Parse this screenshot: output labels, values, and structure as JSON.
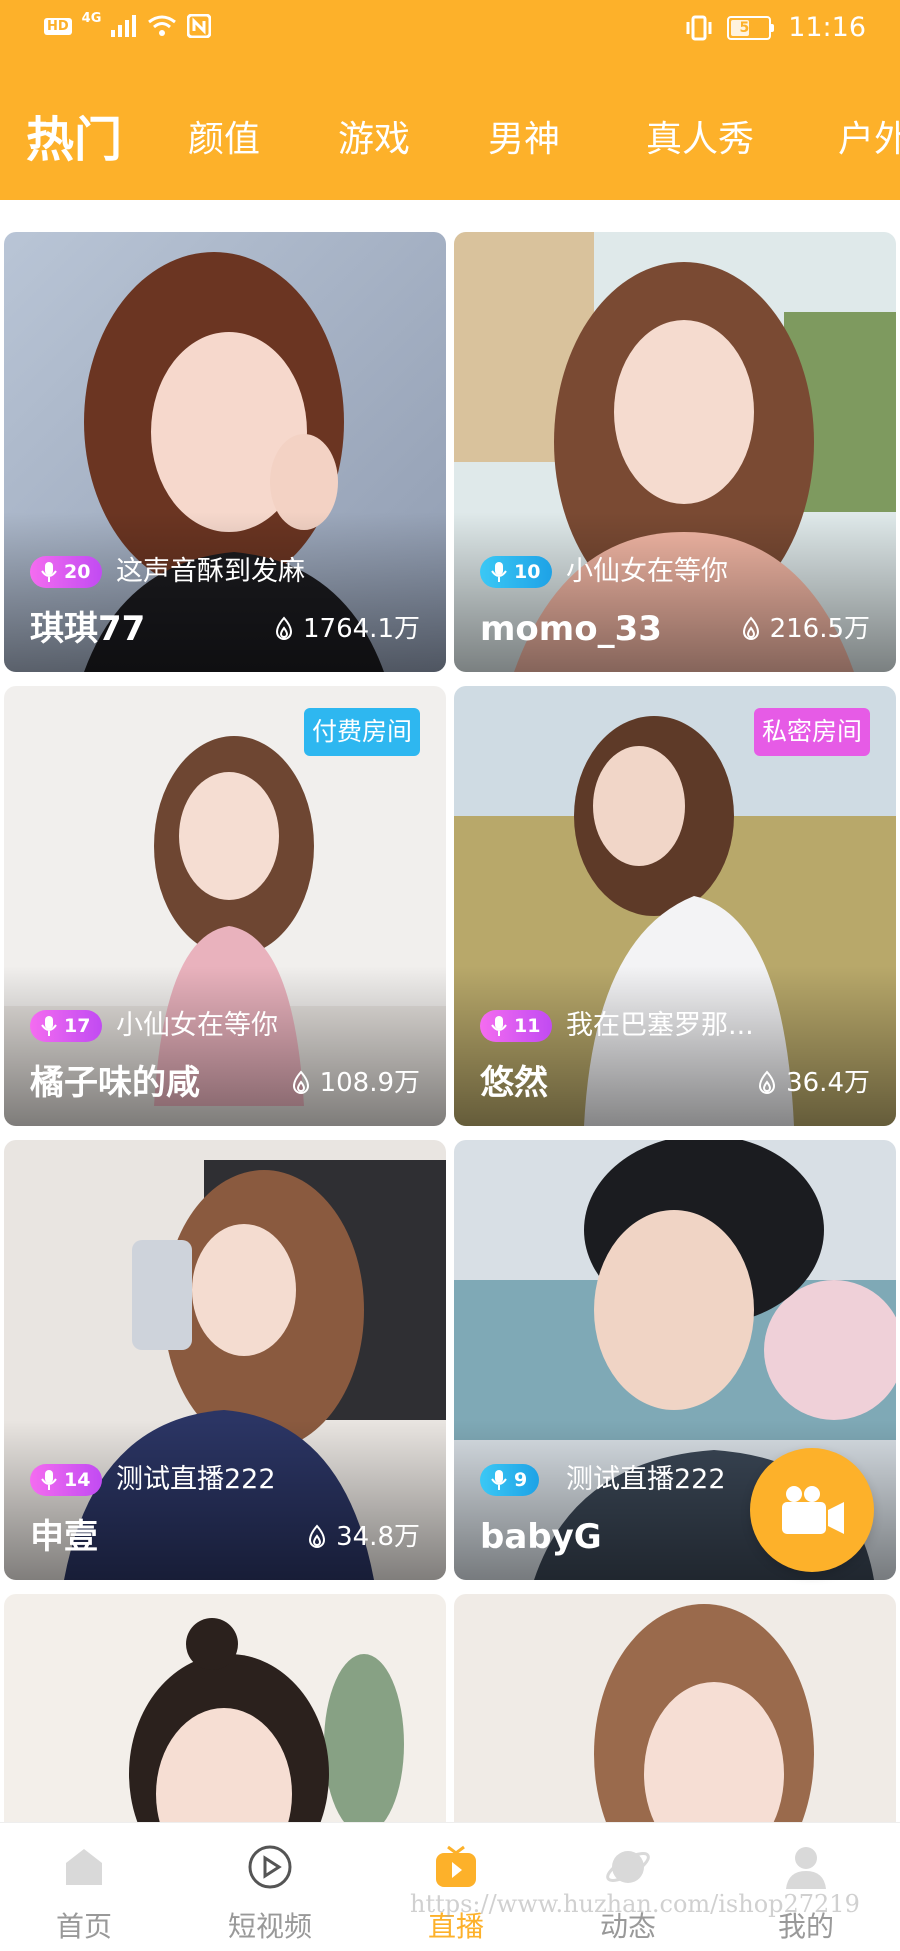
{
  "status_bar": {
    "hd_label": "HD",
    "network": "4G",
    "battery": "50",
    "time": "11:16"
  },
  "tabs": [
    {
      "label": "热门",
      "active": true
    },
    {
      "label": "颜值",
      "active": false
    },
    {
      "label": "游戏",
      "active": false
    },
    {
      "label": "男神",
      "active": false
    },
    {
      "label": "真人秀",
      "active": false
    },
    {
      "label": "户外",
      "active": false
    }
  ],
  "cards": [
    {
      "level": "20",
      "level_color": "pink",
      "title": "这声音酥到发麻",
      "name": "琪琪77",
      "views": "1764.1万",
      "tag": ""
    },
    {
      "level": "10",
      "level_color": "blue",
      "title": "小仙女在等你",
      "name": "momo_33",
      "views": "216.5万",
      "tag": ""
    },
    {
      "level": "17",
      "level_color": "pink",
      "title": "小仙女在等你",
      "name": "橘子味的咸",
      "views": "108.9万",
      "tag": "付费房间"
    },
    {
      "level": "11",
      "level_color": "pink",
      "title": "我在巴塞罗那...",
      "name": "悠然",
      "views": "36.4万",
      "tag": "私密房间"
    },
    {
      "level": "14",
      "level_color": "pink",
      "title": "测试直播222",
      "name": "申壹",
      "views": "34.8万",
      "tag": ""
    },
    {
      "level": "9",
      "level_color": "blue",
      "title": "测试直播222",
      "name": "babyG",
      "views": "",
      "tag": ""
    },
    {
      "level": "",
      "title": "",
      "name": "",
      "views": "",
      "tag": ""
    },
    {
      "level": "",
      "title": "",
      "name": "",
      "views": "",
      "tag": ""
    }
  ],
  "bottom_nav": [
    {
      "label": "首页",
      "icon": "home-icon",
      "active": false
    },
    {
      "label": "短视频",
      "icon": "play-circle-icon",
      "active": false
    },
    {
      "label": "直播",
      "icon": "live-icon",
      "active": true
    },
    {
      "label": "动态",
      "icon": "planet-icon",
      "active": false
    },
    {
      "label": "我的",
      "icon": "user-icon",
      "active": false
    }
  ],
  "watermark": "https://www.huzhan.com/ishop27219",
  "colors": {
    "accent": "#FDB12A",
    "paid_tag": "#2EB7F0",
    "private_tag": "#E65BE6",
    "nav_inactive": "#999999"
  }
}
